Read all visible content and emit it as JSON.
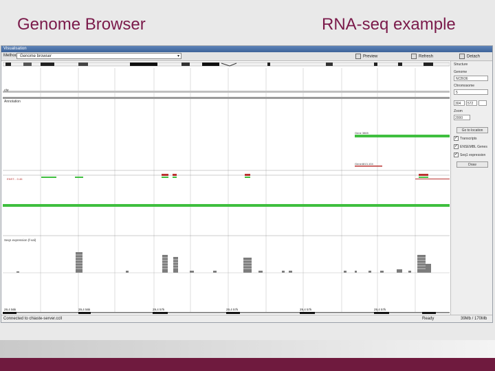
{
  "slide": {
    "title_left": "Genome Browser",
    "title_right": "RNA-seq example"
  },
  "app": {
    "window_title": "Visualisation",
    "toolbar": {
      "method_label": "Method:",
      "method_value": "Genome browser",
      "preview_label": "Preview",
      "refresh_label": "Refresh",
      "detach_label": "Detach"
    },
    "tracks": {
      "ideogram_label": "chr",
      "annotation_label": "Annotation",
      "gene1_label": "Gene 3865",
      "gene2_label": "Gene4813-104",
      "transcript_label": "ENST... 0.46",
      "expression_label": "Seq1 expression (f-val)"
    },
    "axis_ticks": [
      "29,4 56k",
      "29,4 56k",
      "29,4 57k",
      "29,4 57k",
      "29,4 57k",
      "29,4 57k"
    ],
    "side_panel": {
      "structure_label": "Structure",
      "genome_label": "Genome",
      "genome_value": "NCBI36",
      "chromosome_label": "Chromosome",
      "chromosome_value": "5",
      "start_value": "304",
      "end_value": "572",
      "zoom_label": "Zoom",
      "zoom_value": "2000",
      "go_location_label": "Go to location",
      "cb_transcripts_label": "Transcripts",
      "cb_ensembl_label": "ENSEMBL Genes",
      "cb_expression_label": "Seq1 expression",
      "draw_button": "Draw"
    },
    "status": {
      "connection": "Connected to chiaste-server.ccll",
      "ready": "Ready",
      "memory": "39Mb / 170Mb"
    },
    "colors": {
      "gene_green": "#3fbf3f",
      "transcript_red": "#b8322f",
      "bar_gray": "#8a8a8a",
      "accent_bar": "#6f1a3e"
    }
  }
}
